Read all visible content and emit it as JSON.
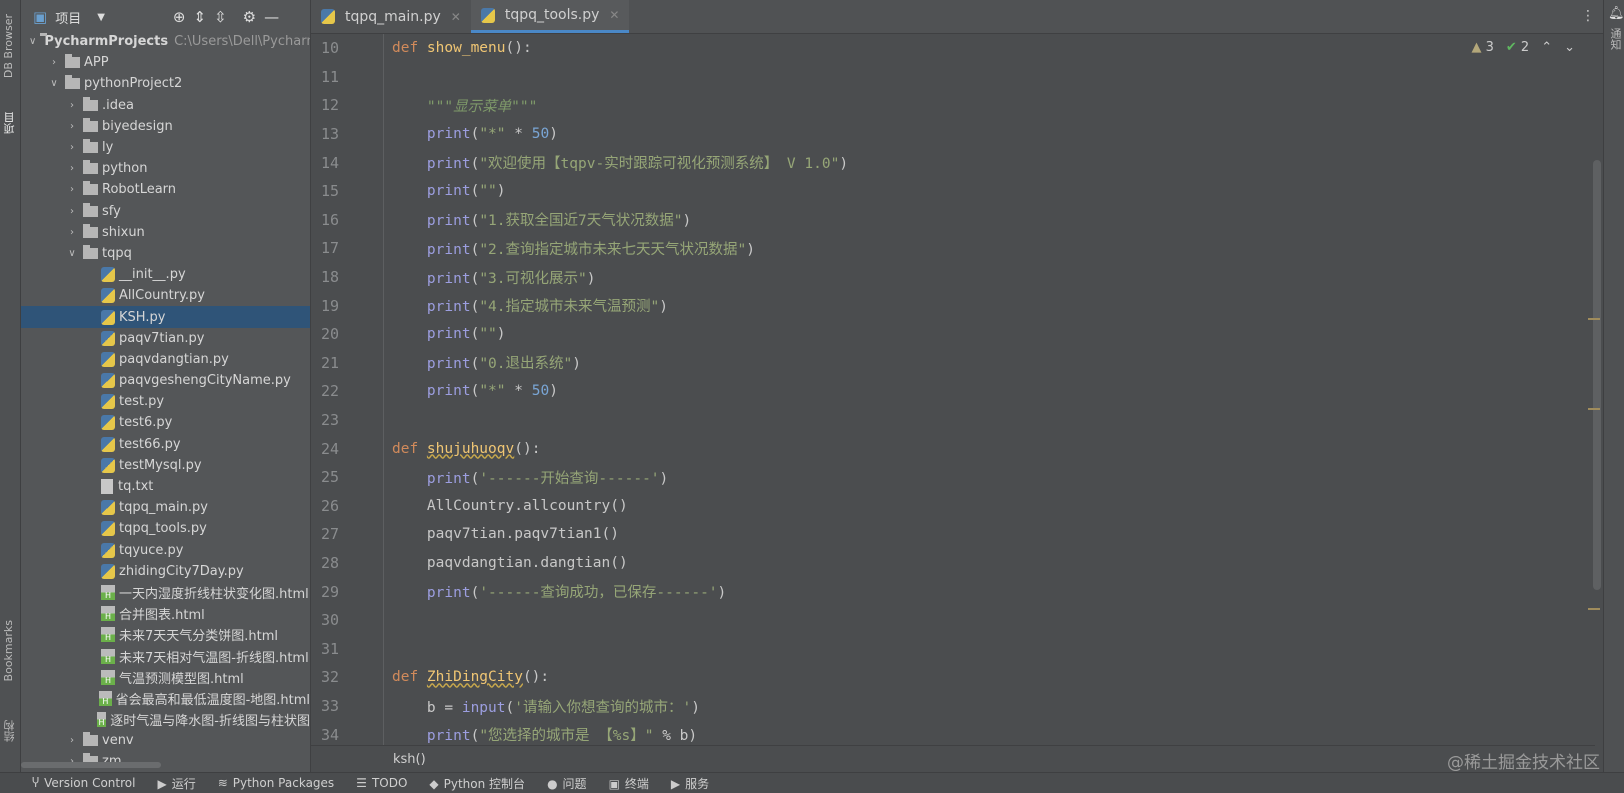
{
  "left_strip": {
    "db_browser": "DB Browser",
    "project": "项目",
    "bookmarks": "Bookmarks",
    "structure": "结构"
  },
  "right_strip": {
    "notifications": "通知"
  },
  "sidebar": {
    "title": "项目",
    "tree": [
      {
        "d": 0,
        "t": "folder",
        "open": true,
        "label": "PycharmProjects",
        "path": "C:\\Users\\Dell\\Pycharm"
      },
      {
        "d": 1,
        "t": "folder",
        "open": false,
        "label": "APP"
      },
      {
        "d": 1,
        "t": "folder",
        "open": true,
        "label": "pythonProject2"
      },
      {
        "d": 2,
        "t": "folder",
        "open": false,
        "label": ".idea"
      },
      {
        "d": 2,
        "t": "folder",
        "open": false,
        "label": "biyedesign"
      },
      {
        "d": 2,
        "t": "folder",
        "open": false,
        "label": "ly"
      },
      {
        "d": 2,
        "t": "folder",
        "open": false,
        "label": "python"
      },
      {
        "d": 2,
        "t": "folder",
        "open": false,
        "label": "RobotLearn"
      },
      {
        "d": 2,
        "t": "folder",
        "open": false,
        "label": "sfy"
      },
      {
        "d": 2,
        "t": "folder",
        "open": false,
        "label": "shixun"
      },
      {
        "d": 2,
        "t": "folder",
        "open": true,
        "label": "tqpq"
      },
      {
        "d": 3,
        "t": "py",
        "label": "__init__.py"
      },
      {
        "d": 3,
        "t": "py",
        "label": "AllCountry.py"
      },
      {
        "d": 3,
        "t": "py",
        "label": "KSH.py",
        "selected": true
      },
      {
        "d": 3,
        "t": "py",
        "label": "paqv7tian.py"
      },
      {
        "d": 3,
        "t": "py",
        "label": "paqvdangtian.py"
      },
      {
        "d": 3,
        "t": "py",
        "label": "paqvgeshengCityName.py"
      },
      {
        "d": 3,
        "t": "py",
        "label": "test.py"
      },
      {
        "d": 3,
        "t": "py",
        "label": "test6.py"
      },
      {
        "d": 3,
        "t": "py",
        "label": "test66.py"
      },
      {
        "d": 3,
        "t": "py",
        "label": "testMysql.py"
      },
      {
        "d": 3,
        "t": "txt",
        "label": "tq.txt"
      },
      {
        "d": 3,
        "t": "py",
        "label": "tqpq_main.py"
      },
      {
        "d": 3,
        "t": "py",
        "label": "tqpq_tools.py"
      },
      {
        "d": 3,
        "t": "py",
        "label": "tqyuce.py"
      },
      {
        "d": 3,
        "t": "py",
        "label": "zhidingCity7Day.py"
      },
      {
        "d": 3,
        "t": "html",
        "label": "一天内湿度折线柱状变化图.html"
      },
      {
        "d": 3,
        "t": "html",
        "label": "合并图表.html"
      },
      {
        "d": 3,
        "t": "html",
        "label": "未来7天天气分类饼图.html"
      },
      {
        "d": 3,
        "t": "html",
        "label": "未来7天相对气温图-折线图.html"
      },
      {
        "d": 3,
        "t": "html",
        "label": "气温预测模型图.html"
      },
      {
        "d": 3,
        "t": "html",
        "label": "省会最高和最低温度图-地图.html"
      },
      {
        "d": 3,
        "t": "html",
        "label": "逐时气温与降水图-折线图与柱状图"
      },
      {
        "d": 2,
        "t": "folder",
        "open": false,
        "label": "venv"
      },
      {
        "d": 2,
        "t": "folder",
        "open": false,
        "label": "zm"
      }
    ]
  },
  "tabs": [
    {
      "label": "tqpq_main.py",
      "active": false
    },
    {
      "label": "tqpq_tools.py",
      "active": true
    }
  ],
  "inspections": {
    "warnings": "3",
    "weak": "2"
  },
  "code": [
    {
      "n": "10",
      "t": [
        [
          "kw",
          "def "
        ],
        [
          "fn",
          "show_menu"
        ],
        [
          "pl",
          "():"
        ]
      ]
    },
    {
      "n": "11",
      "t": []
    },
    {
      "n": "12",
      "t": [
        [
          "pl",
          "    "
        ],
        [
          "doc",
          "\"\"\"显示菜单\"\"\""
        ]
      ]
    },
    {
      "n": "13",
      "t": [
        [
          "pl",
          "    "
        ],
        [
          "bi",
          "print"
        ],
        [
          "pl",
          "("
        ],
        [
          "str",
          "\"*\""
        ],
        [
          "pl",
          " * "
        ],
        [
          "num",
          "50"
        ],
        [
          "pl",
          ")"
        ]
      ]
    },
    {
      "n": "14",
      "t": [
        [
          "pl",
          "    "
        ],
        [
          "bi",
          "print"
        ],
        [
          "pl",
          "("
        ],
        [
          "str",
          "\"欢迎使用【tqpv-实时跟踪可视化预测系统】 V 1.0\""
        ],
        [
          "pl",
          ")"
        ]
      ]
    },
    {
      "n": "15",
      "t": [
        [
          "pl",
          "    "
        ],
        [
          "bi",
          "print"
        ],
        [
          "pl",
          "("
        ],
        [
          "str",
          "\"\""
        ],
        [
          "pl",
          ")"
        ]
      ]
    },
    {
      "n": "16",
      "t": [
        [
          "pl",
          "    "
        ],
        [
          "bi",
          "print"
        ],
        [
          "pl",
          "("
        ],
        [
          "str",
          "\"1.获取全国近7天气状况数据\""
        ],
        [
          "pl",
          ")"
        ]
      ]
    },
    {
      "n": "17",
      "t": [
        [
          "pl",
          "    "
        ],
        [
          "bi",
          "print"
        ],
        [
          "pl",
          "("
        ],
        [
          "str",
          "\"2.查询指定城市未来七天天气状况数据\""
        ],
        [
          "pl",
          ")"
        ]
      ]
    },
    {
      "n": "18",
      "t": [
        [
          "pl",
          "    "
        ],
        [
          "bi",
          "print"
        ],
        [
          "pl",
          "("
        ],
        [
          "str",
          "\"3.可视化展示\""
        ],
        [
          "pl",
          ")"
        ]
      ]
    },
    {
      "n": "19",
      "t": [
        [
          "pl",
          "    "
        ],
        [
          "bi",
          "print"
        ],
        [
          "pl",
          "("
        ],
        [
          "str",
          "\"4.指定城市未来气温预测\""
        ],
        [
          "pl",
          ")"
        ]
      ]
    },
    {
      "n": "20",
      "t": [
        [
          "pl",
          "    "
        ],
        [
          "bi",
          "print"
        ],
        [
          "pl",
          "("
        ],
        [
          "str",
          "\"\""
        ],
        [
          "pl",
          ")"
        ]
      ]
    },
    {
      "n": "21",
      "t": [
        [
          "pl",
          "    "
        ],
        [
          "bi",
          "print"
        ],
        [
          "pl",
          "("
        ],
        [
          "str",
          "\"0.退出系统\""
        ],
        [
          "pl",
          ")"
        ]
      ]
    },
    {
      "n": "22",
      "t": [
        [
          "pl",
          "    "
        ],
        [
          "bi",
          "print"
        ],
        [
          "pl",
          "("
        ],
        [
          "str",
          "\"*\""
        ],
        [
          "pl",
          " * "
        ],
        [
          "num",
          "50"
        ],
        [
          "pl",
          ")"
        ]
      ]
    },
    {
      "n": "23",
      "t": []
    },
    {
      "n": "24",
      "t": [
        [
          "kw",
          "def "
        ],
        [
          "fn wavy",
          "shujuhuoqv"
        ],
        [
          "pl",
          "():"
        ]
      ]
    },
    {
      "n": "25",
      "t": [
        [
          "pl",
          "    "
        ],
        [
          "bi",
          "print"
        ],
        [
          "pl",
          "("
        ],
        [
          "str",
          "'------开始查询------'"
        ],
        [
          "pl",
          ")"
        ]
      ]
    },
    {
      "n": "26",
      "t": [
        [
          "pl",
          "    AllCountry.allcountry()"
        ]
      ]
    },
    {
      "n": "27",
      "t": [
        [
          "pl",
          "    paqv7tian.paqv7tian1()"
        ]
      ]
    },
    {
      "n": "28",
      "t": [
        [
          "pl",
          "    paqvdangtian.dangtian()"
        ]
      ]
    },
    {
      "n": "29",
      "t": [
        [
          "pl",
          "    "
        ],
        [
          "bi",
          "print"
        ],
        [
          "pl",
          "("
        ],
        [
          "str",
          "'------查询成功，已保存------'"
        ],
        [
          "pl",
          ")"
        ]
      ]
    },
    {
      "n": "30",
      "t": []
    },
    {
      "n": "31",
      "t": []
    },
    {
      "n": "32",
      "t": [
        [
          "kw",
          "def "
        ],
        [
          "fn wavy",
          "ZhiDingCity"
        ],
        [
          "pl",
          "():"
        ]
      ]
    },
    {
      "n": "33",
      "t": [
        [
          "pl",
          "    b = "
        ],
        [
          "bi",
          "input"
        ],
        [
          "pl",
          "("
        ],
        [
          "str",
          "'请输入你想查询的城市：'"
        ],
        [
          "pl",
          ")"
        ]
      ]
    },
    {
      "n": "34",
      "t": [
        [
          "pl",
          "    "
        ],
        [
          "bi",
          "print"
        ],
        [
          "pl",
          "("
        ],
        [
          "str",
          "\"您选择的城市是 【%s】\""
        ],
        [
          "pl",
          " % b)"
        ]
      ]
    }
  ],
  "breadcrumb": "ksh()",
  "bottom": [
    {
      "icon": "version-control-icon",
      "g": "Ⴤ",
      "label": "Version Control"
    },
    {
      "icon": "run-icon",
      "g": "▶",
      "label": "运行"
    },
    {
      "icon": "python-packages-icon",
      "g": "≋",
      "label": "Python Packages"
    },
    {
      "icon": "todo-icon",
      "g": "☰",
      "label": "TODO"
    },
    {
      "icon": "python-console-icon",
      "g": "◆",
      "label": "Python 控制台"
    },
    {
      "icon": "problems-icon",
      "g": "●",
      "label": "问题"
    },
    {
      "icon": "terminal-icon",
      "g": "▣",
      "label": "终端"
    },
    {
      "icon": "services-icon",
      "g": "▶",
      "label": "服务"
    }
  ],
  "watermark": "@稀土掘金技术社区"
}
